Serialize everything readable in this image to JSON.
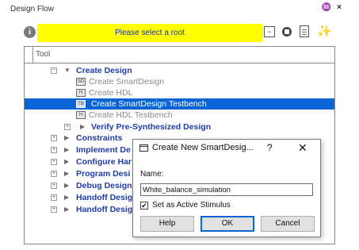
{
  "panel": {
    "title": "Design Flow",
    "controls": {
      "float": "♒",
      "close": "×"
    }
  },
  "toolbar": {
    "info_icon": "info-icon",
    "banner_text": "Please select a root",
    "banner_color": "#ffff00",
    "icons": [
      "collapse-icon",
      "stop-icon",
      "report-icon",
      "settings-wand-icon"
    ]
  },
  "tree": {
    "column_header": "Tool",
    "rows": [
      {
        "label": "Create Design",
        "style": "bold",
        "expander": "−",
        "expanded": true
      },
      {
        "label": "Create SmartDesign",
        "style": "gray",
        "icon": "smartdesign-icon"
      },
      {
        "label": "Create HDL",
        "style": "gray",
        "icon": "hdl-icon"
      },
      {
        "label": "Create SmartDesign Testbench",
        "style": "selected",
        "icon": "testbench-icon"
      },
      {
        "label": "Create HDL Testbench",
        "style": "gray",
        "icon": "hdl-testbench-icon"
      },
      {
        "label": "Verify Pre-Synthesized Design",
        "style": "bold",
        "expander": "+"
      },
      {
        "label": "Constraints",
        "style": "bold",
        "expander": "+"
      },
      {
        "label": "Implement De",
        "style": "bold",
        "expander": "+"
      },
      {
        "label": "Configure Har",
        "style": "bold",
        "expander": "+"
      },
      {
        "label": "Program Desi",
        "style": "bold",
        "expander": "+"
      },
      {
        "label": "Debug Design",
        "style": "bold",
        "expander": "+"
      },
      {
        "label": "Handoff Desig",
        "style": "bold",
        "expander": "+"
      },
      {
        "label": "Handoff Desig",
        "style": "bold",
        "expander": "+"
      }
    ],
    "selection_color": "#0a64d6"
  },
  "dialog": {
    "title": "Create New SmartDesig...",
    "help_glyph": "?",
    "close_glyph": "✕",
    "name_label": "Name:",
    "name_value": "White_balance_simulation",
    "checkbox_label": "Set as Active Stimulus",
    "checkbox_checked": true,
    "buttons": {
      "help": "Help",
      "ok": "OK",
      "cancel": "Cancel"
    }
  }
}
